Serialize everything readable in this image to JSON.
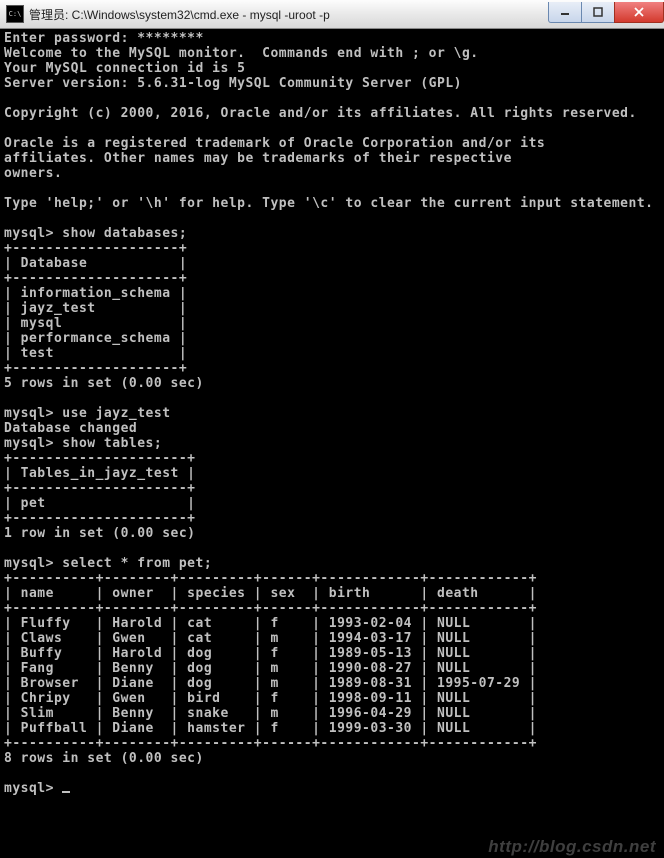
{
  "titlebar": {
    "icon_label": "C:\\",
    "text": "管理员: C:\\Windows\\system32\\cmd.exe - mysql  -uroot -p"
  },
  "window_controls": {
    "min_name": "minimize-icon",
    "max_name": "maximize-icon",
    "close_name": "close-icon"
  },
  "terminal": {
    "lines": [
      "Enter password: ********",
      "Welcome to the MySQL monitor.  Commands end with ; or \\g.",
      "Your MySQL connection id is 5",
      "Server version: 5.6.31-log MySQL Community Server (GPL)",
      "",
      "Copyright (c) 2000, 2016, Oracle and/or its affiliates. All rights reserved.",
      "",
      "Oracle is a registered trademark of Oracle Corporation and/or its",
      "affiliates. Other names may be trademarks of their respective",
      "owners.",
      "",
      "Type 'help;' or '\\h' for help. Type '\\c' to clear the current input statement.",
      "",
      "mysql> show databases;",
      "+--------------------+",
      "| Database           |",
      "+--------------------+",
      "| information_schema |",
      "| jayz_test          |",
      "| mysql              |",
      "| performance_schema |",
      "| test               |",
      "+--------------------+",
      "5 rows in set (0.00 sec)",
      "",
      "mysql> use jayz_test",
      "Database changed",
      "mysql> show tables;",
      "+---------------------+",
      "| Tables_in_jayz_test |",
      "+---------------------+",
      "| pet                 |",
      "+---------------------+",
      "1 row in set (0.00 sec)",
      "",
      "mysql> select * from pet;",
      "+----------+--------+---------+------+------------+------------+",
      "| name     | owner  | species | sex  | birth      | death      |",
      "+----------+--------+---------+------+------------+------------+",
      "| Fluffy   | Harold | cat     | f    | 1993-02-04 | NULL       |",
      "| Claws    | Gwen   | cat     | m    | 1994-03-17 | NULL       |",
      "| Buffy    | Harold | dog     | f    | 1989-05-13 | NULL       |",
      "| Fang     | Benny  | dog     | m    | 1990-08-27 | NULL       |",
      "| Browser  | Diane  | dog     | m    | 1989-08-31 | 1995-07-29 |",
      "| Chripy   | Gwen   | bird    | f    | 1998-09-11 | NULL       |",
      "| Slim     | Benny  | snake   | m    | 1996-04-29 | NULL       |",
      "| Puffball | Diane  | hamster | f    | 1999-03-30 | NULL       |",
      "+----------+--------+---------+------+------------+------------+",
      "8 rows in set (0.00 sec)",
      "",
      "mysql> "
    ],
    "prompt": "mysql> "
  },
  "chart_data": {
    "type": "table",
    "title": "select * from pet",
    "columns": [
      "name",
      "owner",
      "species",
      "sex",
      "birth",
      "death"
    ],
    "rows": [
      [
        "Fluffy",
        "Harold",
        "cat",
        "f",
        "1993-02-04",
        "NULL"
      ],
      [
        "Claws",
        "Gwen",
        "cat",
        "m",
        "1994-03-17",
        "NULL"
      ],
      [
        "Buffy",
        "Harold",
        "dog",
        "f",
        "1989-05-13",
        "NULL"
      ],
      [
        "Fang",
        "Benny",
        "dog",
        "m",
        "1990-08-27",
        "NULL"
      ],
      [
        "Browser",
        "Diane",
        "dog",
        "m",
        "1989-08-31",
        "1995-07-29"
      ],
      [
        "Chripy",
        "Gwen",
        "bird",
        "f",
        "1998-09-11",
        "NULL"
      ],
      [
        "Slim",
        "Benny",
        "snake",
        "m",
        "1996-04-29",
        "NULL"
      ],
      [
        "Puffball",
        "Diane",
        "hamster",
        "f",
        "1999-03-30",
        "NULL"
      ]
    ]
  },
  "databases": [
    "information_schema",
    "jayz_test",
    "mysql",
    "performance_schema",
    "test"
  ],
  "tables_in_jayz_test": [
    "pet"
  ],
  "watermark": "http://blog.csdn.net"
}
